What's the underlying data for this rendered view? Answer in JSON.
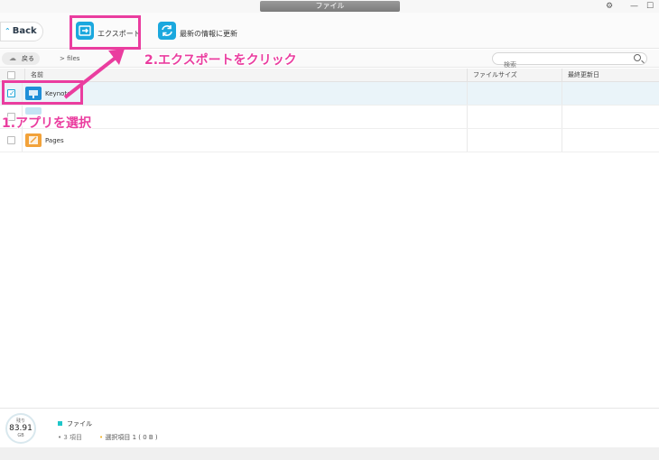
{
  "window": {
    "title": "ファイル"
  },
  "window_controls": {
    "settings": "⚙",
    "minimize": "—",
    "maximize": "☐"
  },
  "toolbar": {
    "back_label": "Back",
    "export_label": "エクスポート",
    "refresh_label": "最新の情報に更新"
  },
  "address": {
    "back_label": "戻る",
    "path": "> files",
    "search_placeholder": "検索"
  },
  "table": {
    "headers": {
      "name": "名前",
      "size": "ファイルサイズ",
      "date": "最終更新日"
    },
    "rows": [
      {
        "name": "Keynote",
        "checked": true,
        "icon_color": "#1f8fd8"
      },
      {
        "name": "",
        "checked": false,
        "icon_color": "#a9d8ef"
      },
      {
        "name": "Pages",
        "checked": false,
        "icon_color": "#f2a23a"
      }
    ]
  },
  "annotations": {
    "step1": "1.アプリを選択",
    "step2": "2.エクスポートをクリック"
  },
  "footer": {
    "storage_label": "残り",
    "storage_value": "83.91",
    "storage_unit": "GB",
    "category": "ファイル",
    "count": "3 項目",
    "selected": "選択項目 1 ( 0 B )"
  },
  "colors": {
    "accent": "#1ba8de",
    "annotation": "#ea3d9f"
  }
}
